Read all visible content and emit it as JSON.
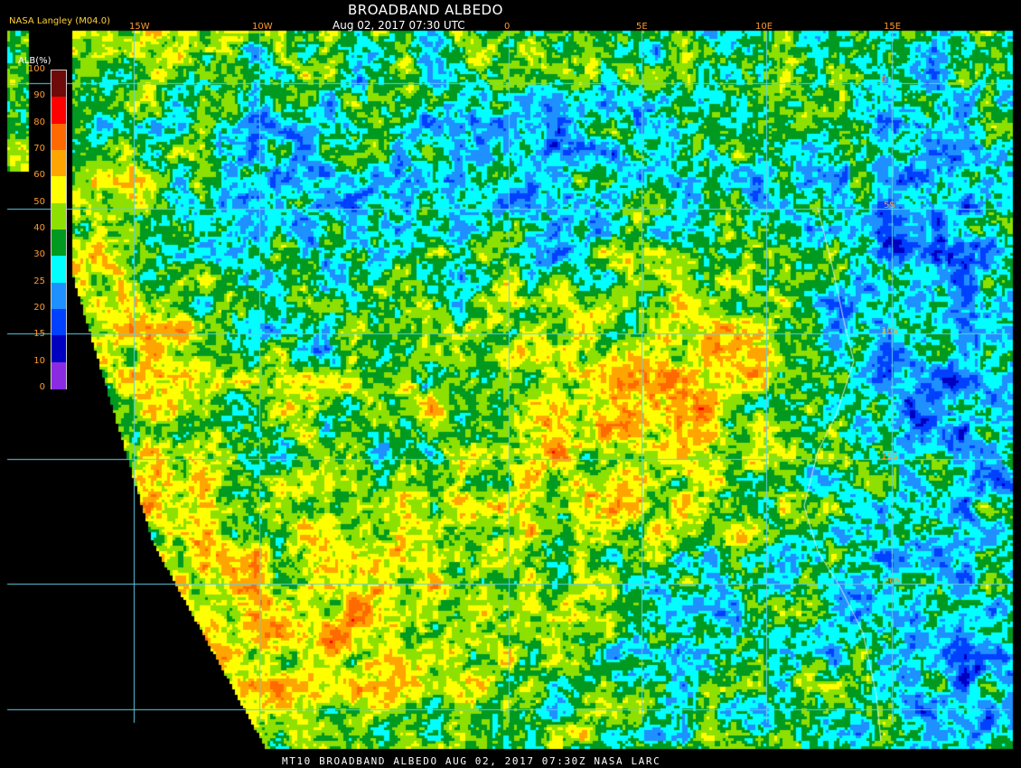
{
  "header": {
    "title": "BROADBAND ALBEDO",
    "subtitle": "Aug 02, 2017 07:30 UTC",
    "credit": "NASA Langley (M04.0)"
  },
  "footer": {
    "text": "MT10  BROADBAND ALBEDO   AUG 02, 2017 07:30Z   NASA LARC"
  },
  "legend": {
    "title": "ALB(%)",
    "ticks": [
      "100",
      "90",
      "80",
      "70",
      "60",
      "50",
      "40",
      "30",
      "25",
      "20",
      "15",
      "10",
      "0"
    ],
    "colors": [
      "#6e0a0a",
      "#ff0000",
      "#ff6a00",
      "#ffa500",
      "#ffff00",
      "#8ee000",
      "#009a20",
      "#00ffff",
      "#1e90ff",
      "#0040ff",
      "#0000c0",
      "#8a2be2"
    ]
  },
  "grid": {
    "lon_labels": [
      "15W",
      "10W",
      "0",
      "5E",
      "10E",
      "15E"
    ],
    "lat_labels": [
      "0",
      "5S",
      "10S",
      "15S",
      "20S"
    ],
    "line_color": "#5fd0e8"
  }
}
